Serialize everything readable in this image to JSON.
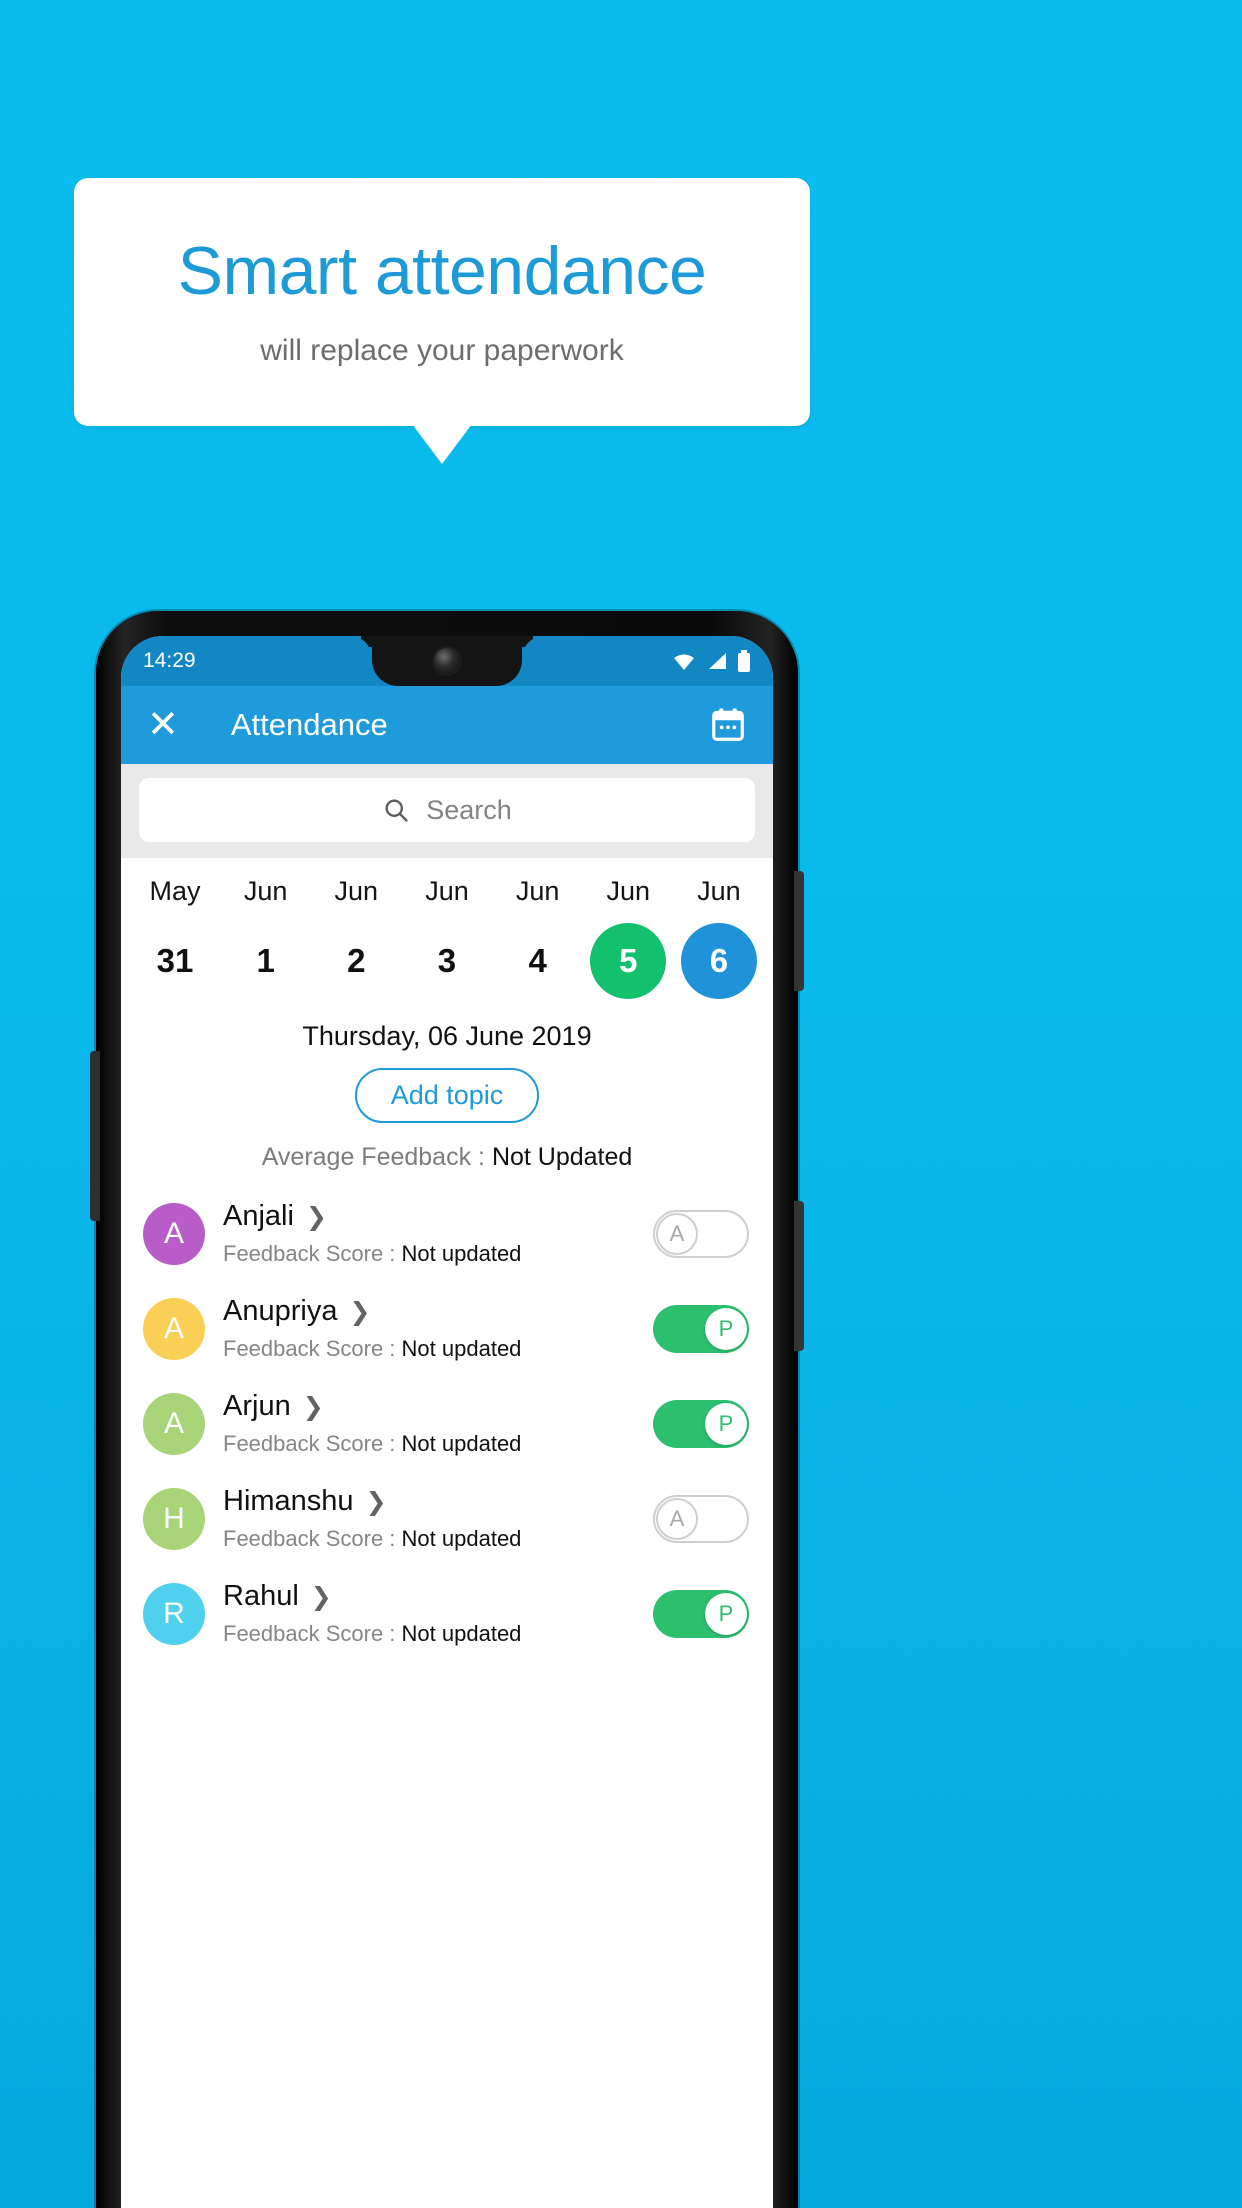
{
  "promo": {
    "title": "Smart attendance",
    "subtitle": "will replace your paperwork",
    "title_color": "#1e9bd7",
    "subtitle_color": "#6d6d6d",
    "background_color": "#0bbdee"
  },
  "phone": {
    "statusbar": {
      "time": "14:29",
      "icons": [
        "wifi-icon",
        "signal-icon",
        "battery-icon"
      ]
    },
    "appbar": {
      "close_label": "✕",
      "title": "Attendance",
      "calendar_icon": "calendar-icon",
      "background_color": "#1f9ada"
    },
    "search": {
      "placeholder": "Search",
      "icon": "search-icon"
    },
    "date_strip": [
      {
        "month": "May",
        "day": "31",
        "state": "normal"
      },
      {
        "month": "Jun",
        "day": "1",
        "state": "normal"
      },
      {
        "month": "Jun",
        "day": "2",
        "state": "normal"
      },
      {
        "month": "Jun",
        "day": "3",
        "state": "normal"
      },
      {
        "month": "Jun",
        "day": "4",
        "state": "normal"
      },
      {
        "month": "Jun",
        "day": "5",
        "state": "green"
      },
      {
        "month": "Jun",
        "day": "6",
        "state": "blue"
      }
    ],
    "selected_date_label": "Thursday, 06 June 2019",
    "add_topic_label": "Add topic",
    "average_feedback_label": "Average Feedback : ",
    "average_feedback_value": "Not Updated",
    "feedback_score_label": "Feedback Score : ",
    "students": [
      {
        "name": "Anjali",
        "initial": "A",
        "avatar_color": "#b85cc8",
        "score": "Not updated",
        "attendance": "A",
        "present": false
      },
      {
        "name": "Anupriya",
        "initial": "A",
        "avatar_color": "#f9cf55",
        "score": "Not updated",
        "attendance": "P",
        "present": true
      },
      {
        "name": "Arjun",
        "initial": "A",
        "avatar_color": "#a8d477",
        "score": "Not updated",
        "attendance": "P",
        "present": true
      },
      {
        "name": "Himanshu",
        "initial": "H",
        "avatar_color": "#a8d477",
        "score": "Not updated",
        "attendance": "A",
        "present": false
      },
      {
        "name": "Rahul",
        "initial": "R",
        "avatar_color": "#4fd0ed",
        "score": "Not updated",
        "attendance": "P",
        "present": true
      }
    ]
  }
}
